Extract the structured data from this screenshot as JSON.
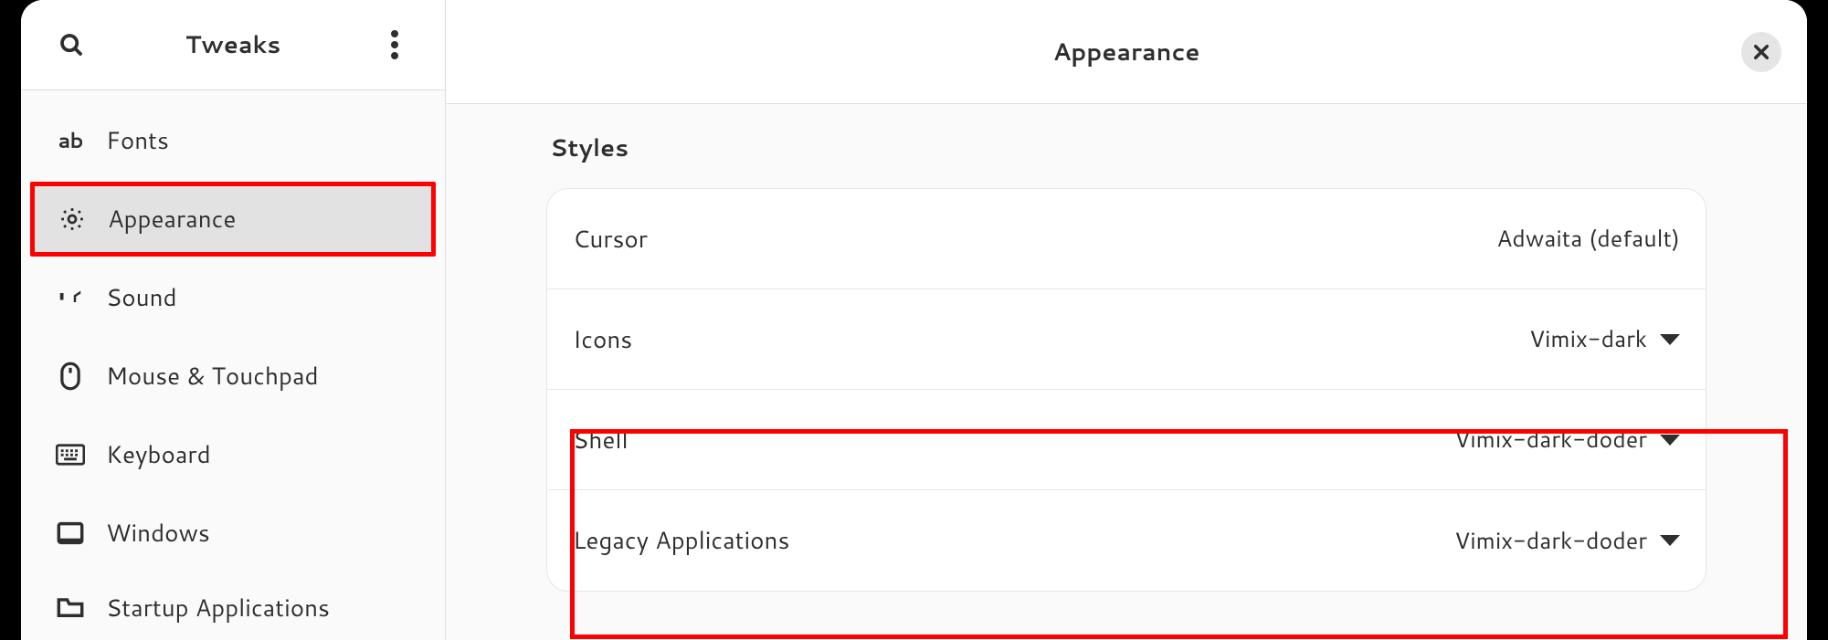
{
  "app": {
    "title": "Tweaks"
  },
  "sidebar": {
    "items": [
      {
        "id": "fonts",
        "label": "Fonts"
      },
      {
        "id": "appearance",
        "label": "Appearance"
      },
      {
        "id": "sound",
        "label": "Sound"
      },
      {
        "id": "mouse-touchpad",
        "label": "Mouse & Touchpad"
      },
      {
        "id": "keyboard",
        "label": "Keyboard"
      },
      {
        "id": "windows",
        "label": "Windows"
      },
      {
        "id": "startup-apps",
        "label": "Startup Applications"
      }
    ],
    "active": "appearance"
  },
  "main": {
    "title": "Appearance",
    "sections": {
      "styles": {
        "heading": "Styles",
        "rows": [
          {
            "id": "cursor",
            "label": "Cursor",
            "value": "Adwaita (default)",
            "dropdown": false
          },
          {
            "id": "icons",
            "label": "Icons",
            "value": "Vimix-dark",
            "dropdown": true
          },
          {
            "id": "shell",
            "label": "Shell",
            "value": "Vimix-dark-doder",
            "dropdown": true
          },
          {
            "id": "legacy",
            "label": "Legacy Applications",
            "value": "Vimix-dark-doder",
            "dropdown": true
          }
        ]
      }
    }
  }
}
